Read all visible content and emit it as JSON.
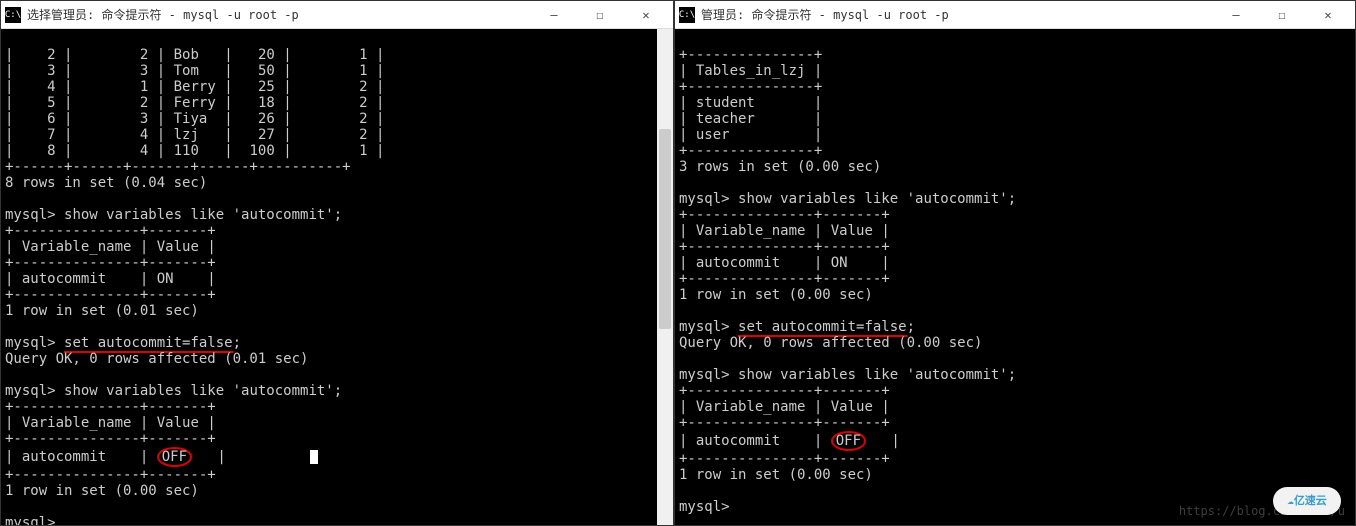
{
  "left": {
    "title": "选择管理员: 命令提示符 - mysql  -u root -p",
    "icon_label": "C:\\",
    "table_rows": [
      {
        "c1": "2",
        "c2": "2",
        "c3": "Bob",
        "c4": "20",
        "c5": "1"
      },
      {
        "c1": "3",
        "c2": "3",
        "c3": "Tom",
        "c4": "50",
        "c5": "1"
      },
      {
        "c1": "4",
        "c2": "1",
        "c3": "Berry",
        "c4": "25",
        "c5": "2"
      },
      {
        "c1": "5",
        "c2": "2",
        "c3": "Ferry",
        "c4": "18",
        "c5": "2"
      },
      {
        "c1": "6",
        "c2": "3",
        "c3": "Tiya",
        "c4": "26",
        "c5": "2"
      },
      {
        "c1": "7",
        "c2": "4",
        "c3": "lzj",
        "c4": "27",
        "c5": "2"
      },
      {
        "c1": "8",
        "c2": "4",
        "c3": "110",
        "c4": "100",
        "c5": "1"
      }
    ],
    "rows_msg1": "8 rows in set (0.04 sec)",
    "prompt": "mysql>",
    "cmd1": "show variables like 'autocommit';",
    "var_header_name": "Variable_name",
    "var_header_value": "Value",
    "var_row1_name": "autocommit",
    "var_row1_value": "ON",
    "rows_msg2": "1 row in set (0.01 sec)",
    "cmd2": "set autocommit=false",
    "cmd2_suffix": ";",
    "query_ok": "Query OK, 0 rows affected (0.01 sec)",
    "cmd3": "show variables like 'autocommit';",
    "var_row2_name": "autocommit",
    "var_row2_value": "OFF",
    "rows_msg3": "1 row in set (0.00 sec)"
  },
  "right": {
    "title": "管理员: 命令提示符 - mysql  -u root -p",
    "icon_label": "C:\\",
    "tables_header": "Tables_in_lzj",
    "tables": [
      "student",
      "teacher",
      "user"
    ],
    "rows_msg1": "3 rows in set (0.00 sec)",
    "prompt": "mysql>",
    "cmd1": "show variables like 'autocommit';",
    "var_header_name": "Variable_name",
    "var_header_value": "Value",
    "var_row1_name": "autocommit",
    "var_row1_value": "ON",
    "rows_msg2": "1 row in set (0.00 sec)",
    "cmd2": "set autocommit=false",
    "cmd2_suffix": ";",
    "query_ok": "Query OK, 0 rows affected (0.00 sec)",
    "cmd3": "show variables like 'autocommit';",
    "var_row2_name": "autocommit",
    "var_row2_value": "OFF",
    "rows_msg3": "1 row in set (0.00 sec)",
    "watermark": "https://blog.csdn.net/u",
    "badge": "亿速云"
  },
  "controls": {
    "min": "—",
    "max": "☐",
    "close": "✕"
  },
  "sep": {
    "top_data": "+------+------+-------+------+----------+",
    "var": "+---------------+-------+",
    "tables": "+---------------+"
  }
}
